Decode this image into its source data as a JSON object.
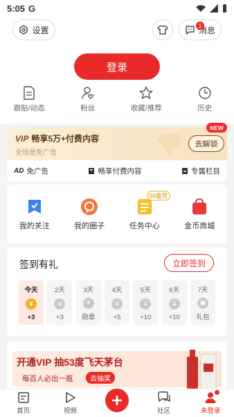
{
  "status": {
    "time": "5:05",
    "carrier_icon": "G"
  },
  "header": {
    "settings_label": "设置",
    "message_label": "消息",
    "message_badge": "1"
  },
  "login": {
    "label": "登录"
  },
  "quick_links": [
    {
      "label": "跟贴/动态",
      "icon": "document-icon"
    },
    {
      "label": "粉丝",
      "icon": "user-heart-icon"
    },
    {
      "label": "收藏/推荐",
      "icon": "star-icon"
    },
    {
      "label": "历史",
      "icon": "clock-icon"
    }
  ],
  "vip": {
    "badge": "VIP",
    "title": "畅享5万+付费内容",
    "subtitle": "全场景免广告",
    "unlock_label": "去解锁",
    "new_tag": "NEW",
    "perks": [
      {
        "label": "免广告",
        "icon_text": "AD"
      },
      {
        "label": "畅享付费内容"
      },
      {
        "label": "专属栏目"
      }
    ]
  },
  "features": [
    {
      "label": "我的关注"
    },
    {
      "label": "我的圈子"
    },
    {
      "label": "任务中心",
      "tag": "50金币"
    },
    {
      "label": "金币商城"
    }
  ],
  "signin": {
    "title": "签到有礼",
    "button": "立即签到",
    "days": [
      {
        "day": "今天",
        "reward": "+3",
        "icon": "¥"
      },
      {
        "day": "2天",
        "reward": "+3",
        "icon": "¥"
      },
      {
        "day": "3天",
        "reward": "勋章",
        "icon": "✦"
      },
      {
        "day": "4天",
        "reward": "+5",
        "icon": "¥"
      },
      {
        "day": "5天",
        "reward": "+10",
        "icon": "¥"
      },
      {
        "day": "6天",
        "reward": "+10",
        "icon": "¥"
      },
      {
        "day": "7天",
        "reward": "礼包",
        "icon": "▣"
      }
    ]
  },
  "promo": {
    "title": "开通VIP 抽53度飞天茅台",
    "subtitle": "每百人必出一瓶",
    "button": "去抽奖"
  },
  "tabbar": [
    {
      "label": "首页"
    },
    {
      "label": "视频"
    },
    {
      "label": ""
    },
    {
      "label": "社区"
    },
    {
      "label": "未登录"
    }
  ],
  "colors": {
    "accent": "#e82b28",
    "vip_text": "#5b3a16",
    "gold": "#f2b01e"
  }
}
